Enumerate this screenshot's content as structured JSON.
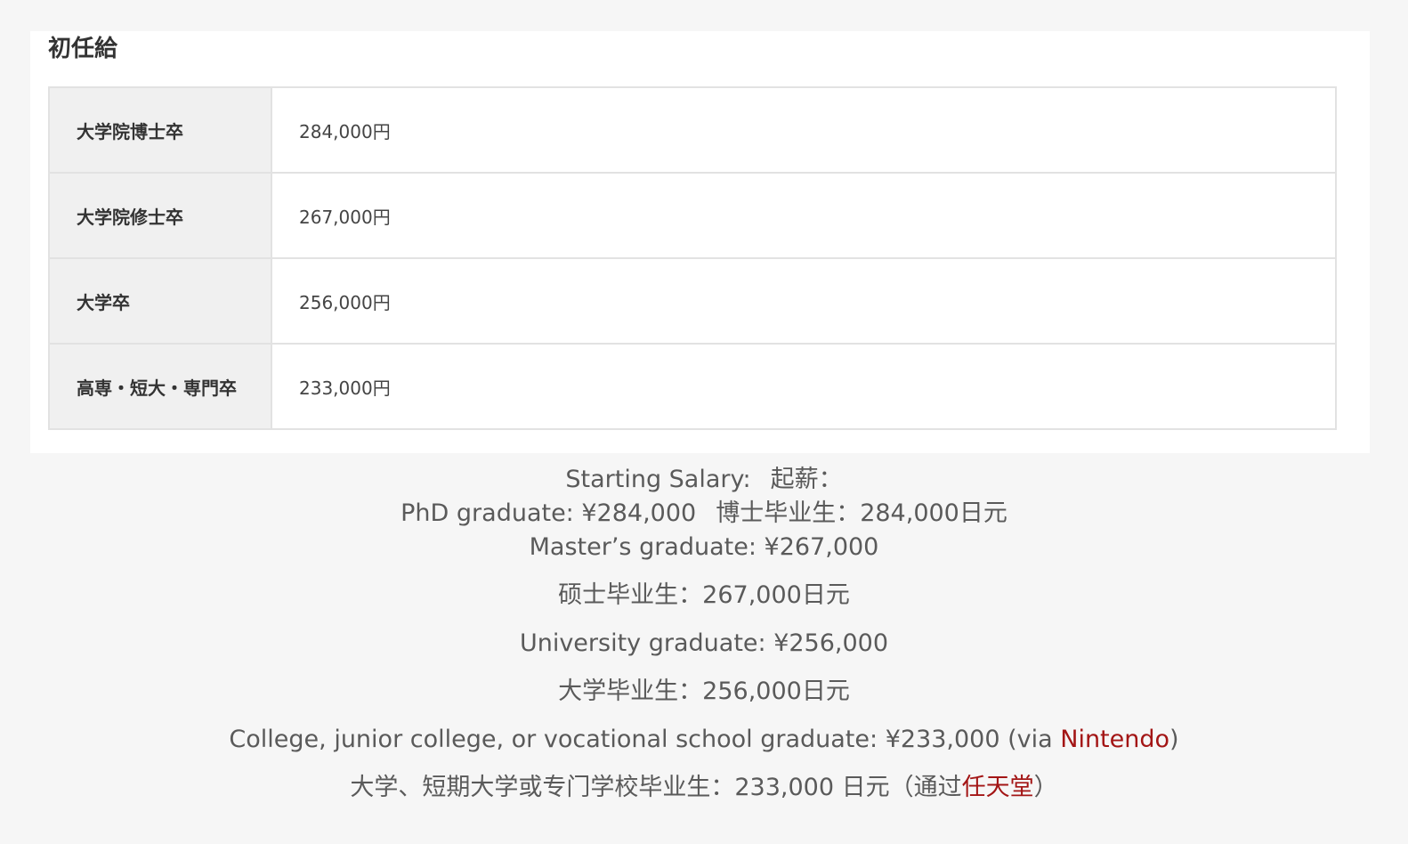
{
  "card": {
    "title": "初任給",
    "rows": [
      {
        "label": "大学院博士卒",
        "value": "284,000円"
      },
      {
        "label": "大学院修士卒",
        "value": "267,000円"
      },
      {
        "label": "大学卒",
        "value": "256,000円"
      },
      {
        "label": "高専・短大・専門卒",
        "value": "233,000円"
      }
    ]
  },
  "caption": {
    "line1_en": "Starting Salary:",
    "line1_zh": "起薪：",
    "line2_en": "PhD graduate: ¥284,000",
    "line2_zh": "博士毕业生：284,000日元",
    "line3": "Master’s graduate: ¥267,000",
    "line4": "硕士毕业生：267,000日元",
    "line5": "University graduate: ¥256,000",
    "line6": "大学毕业生：256,000日元",
    "line7_prefix": "College, junior college, or vocational school graduate: ¥233,000 (via ",
    "line7_link": "Nintendo",
    "line7_suffix": ")",
    "line8_prefix": "大学、短期大学或专门学校毕业生：233,000 日元（通过",
    "line8_link": "任天堂",
    "line8_suffix": "）",
    "link_color": "#a31515"
  }
}
